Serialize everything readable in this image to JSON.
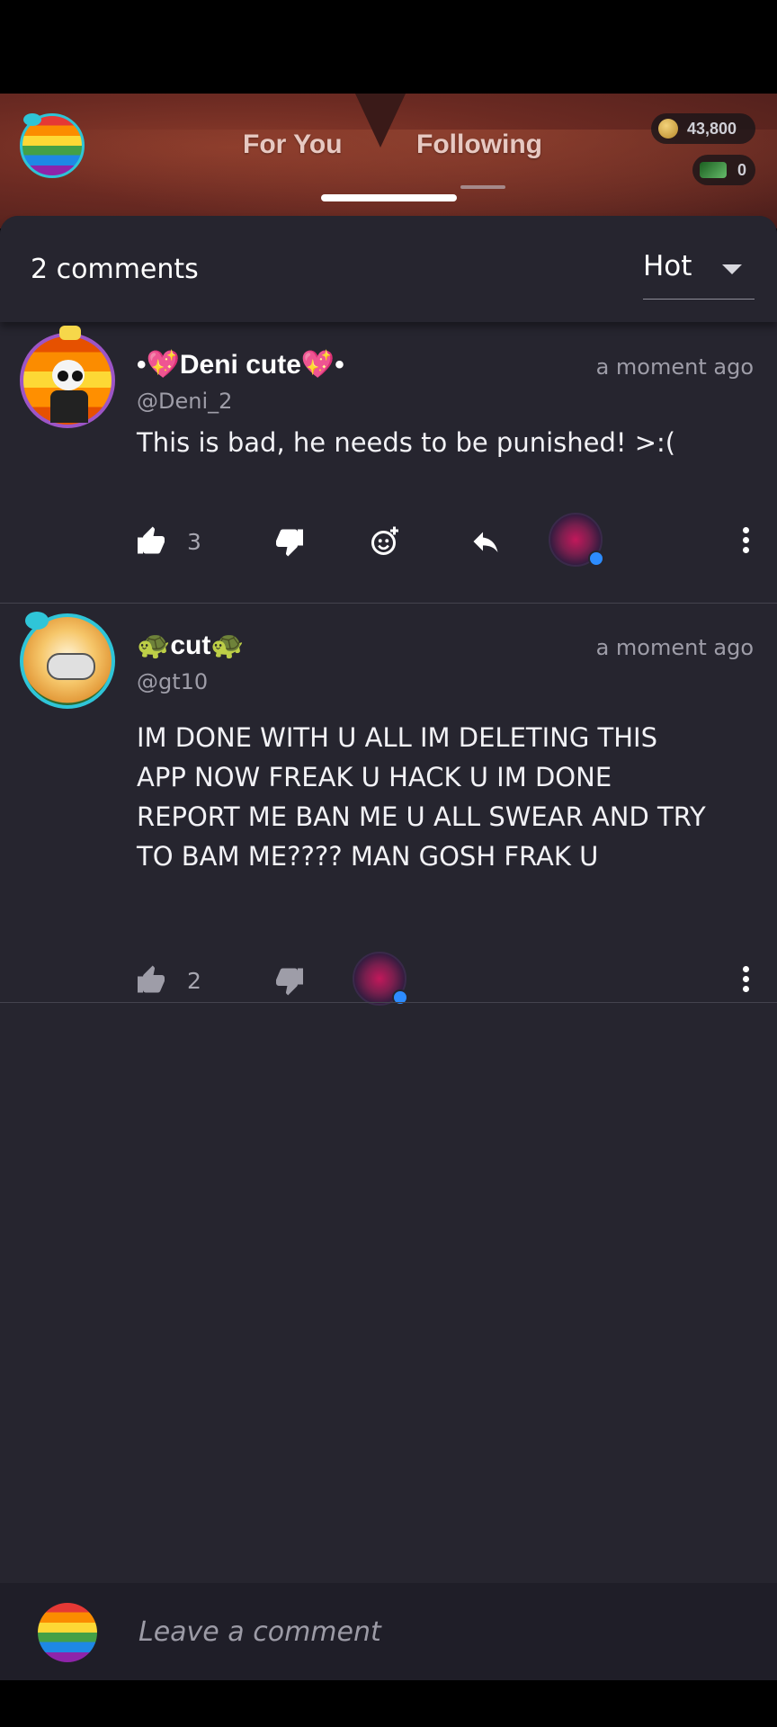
{
  "header": {
    "tabs": [
      {
        "label": "For You",
        "active": false
      },
      {
        "label": "Following",
        "active": true
      }
    ],
    "wallet": {
      "coins": "43,800",
      "bills": "0"
    }
  },
  "sheet": {
    "comment_count_label": "2 comments",
    "sort": {
      "selected": "Hot"
    }
  },
  "comments": [
    {
      "username": "•💖Deni cute💖•",
      "handle": "@Deni_2",
      "time": "a moment ago",
      "text": "This is bad, he needs to be punished! >:(",
      "likes": "3"
    },
    {
      "username": "🐢cut🐢",
      "handle": "@gt10",
      "time": "a moment ago",
      "text": "IM DONE WITH U ALL IM DELETING THIS APP NOW FREAK U HACK U IM DONE REPORT ME BAN ME U ALL SWEAR AND TRY TO BAM ME???? MAN GOSH FRAK U",
      "likes": "2"
    }
  ],
  "composer": {
    "placeholder": "Leave a comment"
  },
  "colors": {
    "sheet_bg": "#26252f",
    "accent_blue": "#2d8cff",
    "header_red": "#6b2a22"
  }
}
